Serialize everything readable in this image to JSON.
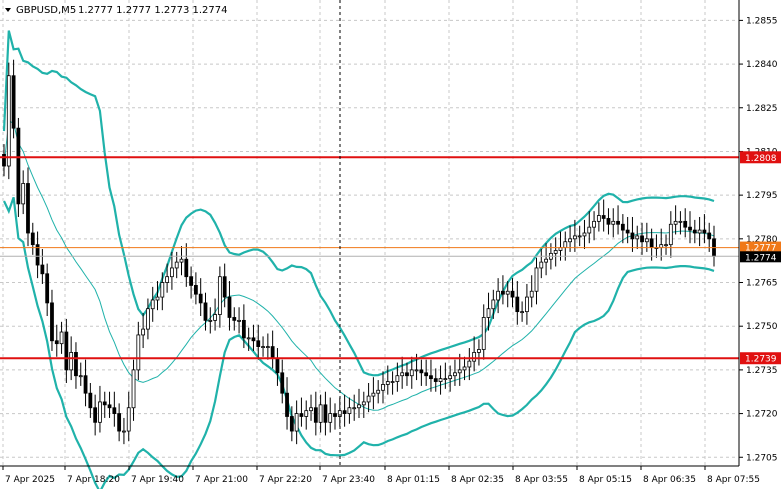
{
  "header": {
    "symbol": "GBPUSD,M5",
    "ohlc": "1.2777 1.2777 1.2773 1.2774"
  },
  "price_axis": {
    "ticks": [
      "1.2855",
      "1.2840",
      "1.2825",
      "1.2810",
      "1.2795",
      "1.2780",
      "1.2765",
      "1.2750",
      "1.2735",
      "1.2720",
      "1.2705"
    ]
  },
  "time_axis": {
    "ticks": [
      "7 Apr 2025",
      "7 Apr 18:20",
      "7 Apr 19:40",
      "7 Apr 21:00",
      "7 Apr 22:20",
      "7 Apr 23:40",
      "8 Apr 01:15",
      "8 Apr 02:35",
      "8 Apr 03:55",
      "8 Apr 05:15",
      "8 Apr 06:35",
      "8 Apr 07:55"
    ]
  },
  "levels": [
    {
      "name": "resistance",
      "price": 1.2808,
      "label": "1.2808",
      "color": "#e01010"
    },
    {
      "name": "support",
      "price": 1.2739,
      "label": "1.2739",
      "color": "#e01010"
    }
  ],
  "markers": {
    "ask": {
      "price": 1.2777,
      "label": "1.2777",
      "color": "#f07818"
    },
    "bid": {
      "price": 1.2774,
      "label": "1.2774",
      "color": "#000000"
    }
  },
  "colors": {
    "bollinger": "#20b2aa",
    "candle": "#000000",
    "grid": "#c8c8c8"
  },
  "chart_data": {
    "type": "candlestick",
    "symbol": "GBPUSD",
    "timeframe": "M5",
    "ylim": [
      1.2702,
      1.2862
    ],
    "close_series": [
      1.2805,
      1.2836,
      1.2818,
      1.2792,
      1.2799,
      1.2782,
      1.2778,
      1.2771,
      1.2768,
      1.2758,
      1.2745,
      1.2744,
      1.2748,
      1.2735,
      1.2741,
      1.2733,
      1.2733,
      1.2727,
      1.2722,
      1.2717,
      1.2724,
      1.2723,
      1.2722,
      1.272,
      1.2714,
      1.2714,
      1.2722,
      1.2735,
      1.2747,
      1.2749,
      1.2756,
      1.2759,
      1.276,
      1.2765,
      1.2767,
      1.277,
      1.2772,
      1.2773,
      1.2767,
      1.2764,
      1.2761,
      1.2758,
      1.2752,
      1.2752,
      1.2754,
      1.2767,
      1.276,
      1.2753,
      1.2752,
      1.2752,
      1.2746,
      1.2746,
      1.2745,
      1.2743,
      1.2743,
      1.2743,
      1.2739,
      1.2734,
      1.2727,
      1.2719,
      1.2714,
      1.272,
      1.2719,
      1.2721,
      1.2722,
      1.2717,
      1.2723,
      1.2717,
      1.272,
      1.2719,
      1.2721,
      1.272,
      1.2722,
      1.2722,
      1.2723,
      1.2724,
      1.2726,
      1.2727,
      1.2728,
      1.273,
      1.2731,
      1.2731,
      1.2733,
      1.2734,
      1.2733,
      1.2735,
      1.2735,
      1.2734,
      1.2733,
      1.2732,
      1.2731,
      1.2732,
      1.2732,
      1.2733,
      1.2734,
      1.2735,
      1.2736,
      1.2738,
      1.2741,
      1.2742,
      1.2753,
      1.2756,
      1.2759,
      1.2762,
      1.2761,
      1.2762,
      1.276,
      1.2755,
      1.2755,
      1.276,
      1.2762,
      1.277,
      1.2772,
      1.2773,
      1.2775,
      1.2776,
      1.2777,
      1.2779,
      1.278,
      1.2781,
      1.2781,
      1.2782,
      1.2784,
      1.2786,
      1.2788,
      1.2787,
      1.2785,
      1.2786,
      1.2785,
      1.2783,
      1.2782,
      1.278,
      1.2781,
      1.2779,
      1.278,
      1.2777,
      1.2777,
      1.2778,
      1.2778,
      1.2785,
      1.2786,
      1.2786,
      1.2784,
      1.2783,
      1.2782,
      1.2783,
      1.2782,
      1.278,
      1.2774
    ]
  }
}
